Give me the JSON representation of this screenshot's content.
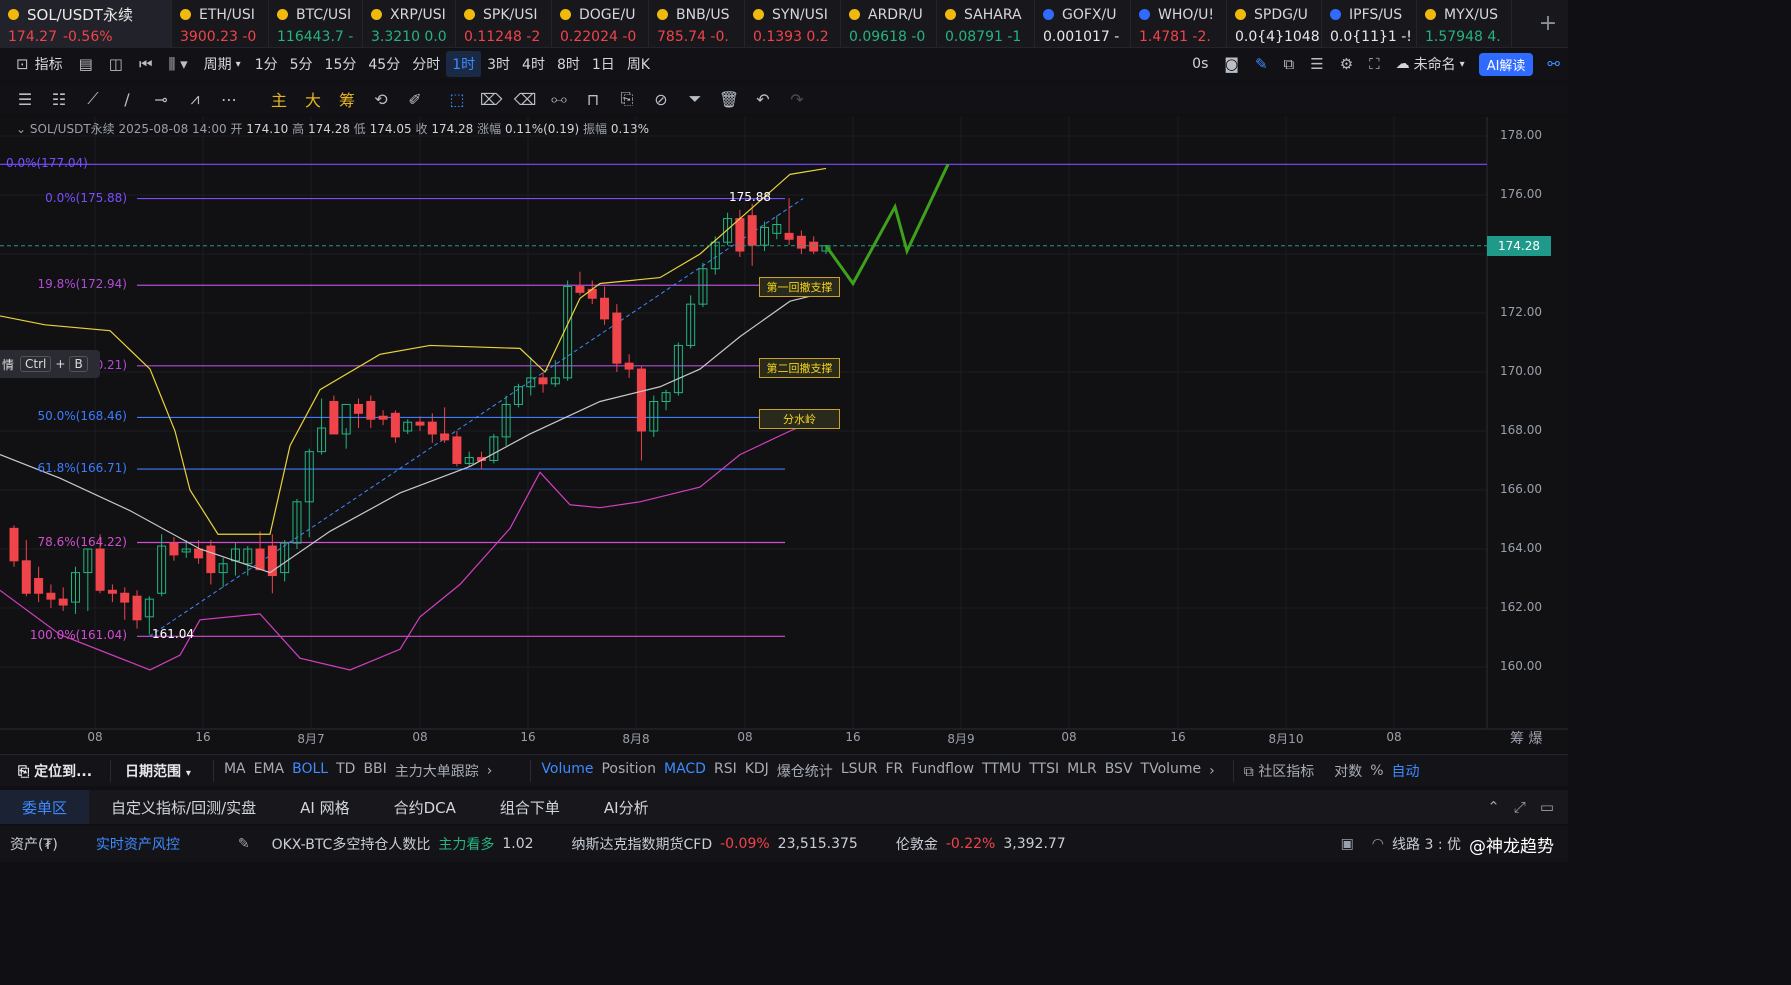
{
  "tickers": [
    {
      "name": "SOL/USDT永续",
      "price": "174.27",
      "change": "-0.56%",
      "dir": "down",
      "active": true
    },
    {
      "name": "ETH/USI",
      "price": "3900.23 -0",
      "dir": "down"
    },
    {
      "name": "BTC/USI",
      "price": "116443.7 -",
      "dir": "up"
    },
    {
      "name": "XRP/USI",
      "price": "3.3210 0.0",
      "dir": "up"
    },
    {
      "name": "SPK/USI",
      "price": "0.11248 -2",
      "dir": "down"
    },
    {
      "name": "DOGE/U",
      "price": "0.22024 -0",
      "dir": "down"
    },
    {
      "name": "BNB/US",
      "price": "785.74 -0.",
      "dir": "down"
    },
    {
      "name": "SYN/USI",
      "price": "0.1393 0.2",
      "dir": "down"
    },
    {
      "name": "ARDR/U",
      "price": "0.09618 -0",
      "dir": "up"
    },
    {
      "name": "SAHARA",
      "price": "0.08791 -1",
      "dir": "up"
    },
    {
      "name": "GOFX/U",
      "price": "0.001017 -",
      "dir": "flat"
    },
    {
      "name": "WHO/U!",
      "price": "1.4781 -2.",
      "dir": "down"
    },
    {
      "name": "SPDG/U",
      "price": "0.0{4}1048",
      "dir": "flat"
    },
    {
      "name": "IPFS/US",
      "price": "0.0{11}1 -!",
      "dir": "flat"
    },
    {
      "name": "MYX/US",
      "price": "1.57948 4.",
      "dir": "up"
    }
  ],
  "toolbar1": {
    "indicator": "指标",
    "period": "周期",
    "intervals": [
      "1分",
      "5分",
      "15分",
      "45分",
      "分时",
      "1时",
      "3时",
      "4时",
      "8时",
      "1日",
      "周K"
    ],
    "selected_interval": "1时",
    "countdown": "0s",
    "layout_name": "未命名",
    "ai_button": "AI解读"
  },
  "toolbar2": {
    "zhu": "主",
    "da": "大",
    "chou": "筹"
  },
  "infobar": {
    "symbol": "SOL/USDT永续",
    "datetime": "2025-08-08 14:00",
    "open_label": "开",
    "open": "174.10",
    "high_label": "高",
    "high": "174.28",
    "low_label": "低",
    "low": "174.05",
    "close_label": "收",
    "close": "174.28",
    "chg_label": "涨幅",
    "chg": "0.11%(0.19)",
    "amp_label": "振幅",
    "amp": "0.13%"
  },
  "fib_levels": [
    {
      "label": "0.0%(177.04)",
      "price": 177.04,
      "color": "#7b4dff"
    },
    {
      "label": "0.0%(175.88)",
      "price": 175.88,
      "color": "#7b4dff"
    },
    {
      "label": "19.8%(172.94)",
      "price": 172.94,
      "color": "#b04dd6"
    },
    {
      "label": "0.21)",
      "price": 170.21,
      "color": "#b04dd6"
    },
    {
      "label": "50.0%(168.46)",
      "price": 168.46,
      "color": "#3d7bff"
    },
    {
      "label": "61.8%(166.71)",
      "price": 166.71,
      "color": "#3d7bff"
    },
    {
      "label": "78.6%(164.22)",
      "price": 164.22,
      "color": "#d04fd0"
    },
    {
      "label": "100.0%(161.04)",
      "price": 161.04,
      "color": "#d04fd0"
    }
  ],
  "annotations": {
    "note1": "第一回撤支撑",
    "note2": "第二回撤支撑",
    "note3": "分水岭",
    "high_marker": "175.88",
    "low_marker": "161.04"
  },
  "last_price": "174.28",
  "y_axis": [
    "178.00",
    "176.00",
    "174.28",
    "172.00",
    "170.00",
    "168.00",
    "166.00",
    "164.00",
    "162.00",
    "160.00"
  ],
  "x_axis": [
    "08",
    "16",
    "8月7",
    "08",
    "16",
    "8月8",
    "08",
    "16",
    "8月9",
    "08",
    "16",
    "8月10",
    "08"
  ],
  "tooltip": {
    "text": "情",
    "key1": "Ctrl",
    "plus": "+",
    "key2": "B"
  },
  "candles": [
    {
      "o": 164.7,
      "h": 164.8,
      "l": 163.4,
      "c": 163.6
    },
    {
      "o": 163.6,
      "h": 164.3,
      "l": 162.4,
      "c": 162.5
    },
    {
      "o": 163.0,
      "h": 163.4,
      "l": 162.2,
      "c": 162.5
    },
    {
      "o": 162.5,
      "h": 162.8,
      "l": 162.0,
      "c": 162.3
    },
    {
      "o": 162.3,
      "h": 162.7,
      "l": 161.9,
      "c": 162.1
    },
    {
      "o": 162.2,
      "h": 163.4,
      "l": 161.8,
      "c": 163.2
    },
    {
      "o": 163.2,
      "h": 164.0,
      "l": 161.9,
      "c": 164.0
    },
    {
      "o": 164.0,
      "h": 164.5,
      "l": 162.5,
      "c": 162.6
    },
    {
      "o": 162.6,
      "h": 162.8,
      "l": 162.2,
      "c": 162.5
    },
    {
      "o": 162.5,
      "h": 162.7,
      "l": 161.6,
      "c": 162.2
    },
    {
      "o": 162.4,
      "h": 162.6,
      "l": 161.3,
      "c": 161.6
    },
    {
      "o": 161.7,
      "h": 162.4,
      "l": 161.1,
      "c": 162.3
    },
    {
      "o": 162.5,
      "h": 164.5,
      "l": 162.4,
      "c": 164.1
    },
    {
      "o": 164.2,
      "h": 164.4,
      "l": 163.6,
      "c": 163.8
    },
    {
      "o": 163.9,
      "h": 164.3,
      "l": 163.7,
      "c": 164.0
    },
    {
      "o": 164.0,
      "h": 164.3,
      "l": 163.5,
      "c": 163.7
    },
    {
      "o": 164.1,
      "h": 164.3,
      "l": 162.8,
      "c": 163.2
    },
    {
      "o": 163.2,
      "h": 163.7,
      "l": 162.7,
      "c": 163.5
    },
    {
      "o": 163.6,
      "h": 164.2,
      "l": 163.1,
      "c": 164.0
    },
    {
      "o": 163.5,
      "h": 164.1,
      "l": 163.1,
      "c": 164.0
    },
    {
      "o": 164.0,
      "h": 164.6,
      "l": 163.5,
      "c": 163.3
    },
    {
      "o": 164.1,
      "h": 164.5,
      "l": 162.5,
      "c": 163.1
    },
    {
      "o": 163.2,
      "h": 164.3,
      "l": 162.9,
      "c": 164.2
    },
    {
      "o": 164.2,
      "h": 165.7,
      "l": 164.0,
      "c": 165.6
    },
    {
      "o": 165.6,
      "h": 167.4,
      "l": 164.4,
      "c": 167.3
    },
    {
      "o": 167.3,
      "h": 169.1,
      "l": 167.2,
      "c": 168.1
    },
    {
      "o": 169.0,
      "h": 169.2,
      "l": 168.2,
      "c": 167.9
    },
    {
      "o": 167.9,
      "h": 168.1,
      "l": 167.4,
      "c": 168.9
    },
    {
      "o": 168.9,
      "h": 169.1,
      "l": 168.1,
      "c": 168.6
    },
    {
      "o": 169.0,
      "h": 169.2,
      "l": 168.1,
      "c": 168.4
    },
    {
      "o": 168.5,
      "h": 168.7,
      "l": 168.2,
      "c": 168.4
    },
    {
      "o": 168.6,
      "h": 168.7,
      "l": 167.6,
      "c": 167.8
    },
    {
      "o": 168.0,
      "h": 168.4,
      "l": 167.9,
      "c": 168.3
    },
    {
      "o": 168.3,
      "h": 168.5,
      "l": 168.0,
      "c": 168.2
    },
    {
      "o": 168.3,
      "h": 168.6,
      "l": 167.6,
      "c": 167.9
    },
    {
      "o": 167.9,
      "h": 168.8,
      "l": 167.6,
      "c": 167.7
    },
    {
      "o": 167.8,
      "h": 168.0,
      "l": 166.8,
      "c": 166.9
    },
    {
      "o": 166.9,
      "h": 167.3,
      "l": 166.8,
      "c": 167.1
    },
    {
      "o": 167.1,
      "h": 167.3,
      "l": 166.7,
      "c": 167.0
    },
    {
      "o": 167.0,
      "h": 167.9,
      "l": 166.9,
      "c": 167.8
    },
    {
      "o": 167.8,
      "h": 169.2,
      "l": 167.5,
      "c": 168.9
    },
    {
      "o": 168.9,
      "h": 169.6,
      "l": 168.8,
      "c": 169.5
    },
    {
      "o": 169.5,
      "h": 170.5,
      "l": 169.2,
      "c": 169.8
    },
    {
      "o": 169.8,
      "h": 170.0,
      "l": 169.3,
      "c": 169.6
    },
    {
      "o": 169.6,
      "h": 170.4,
      "l": 169.5,
      "c": 169.8
    },
    {
      "o": 169.8,
      "h": 173.1,
      "l": 169.7,
      "c": 172.9
    },
    {
      "o": 172.9,
      "h": 173.4,
      "l": 172.6,
      "c": 172.7
    },
    {
      "o": 172.8,
      "h": 173.1,
      "l": 172.3,
      "c": 172.5
    },
    {
      "o": 172.5,
      "h": 172.9,
      "l": 171.6,
      "c": 171.8
    },
    {
      "o": 172.0,
      "h": 172.3,
      "l": 170.0,
      "c": 170.3
    },
    {
      "o": 170.3,
      "h": 170.6,
      "l": 169.8,
      "c": 170.1
    },
    {
      "o": 170.1,
      "h": 170.2,
      "l": 167.0,
      "c": 168.0
    },
    {
      "o": 168.0,
      "h": 169.2,
      "l": 167.8,
      "c": 169.0
    },
    {
      "o": 169.0,
      "h": 169.4,
      "l": 168.7,
      "c": 169.3
    },
    {
      "o": 169.3,
      "h": 171.0,
      "l": 169.2,
      "c": 170.9
    },
    {
      "o": 170.9,
      "h": 172.6,
      "l": 170.8,
      "c": 172.3
    },
    {
      "o": 172.3,
      "h": 173.7,
      "l": 172.2,
      "c": 173.5
    },
    {
      "o": 173.5,
      "h": 174.6,
      "l": 173.3,
      "c": 174.4
    },
    {
      "o": 174.4,
      "h": 175.4,
      "l": 174.3,
      "c": 175.2
    },
    {
      "o": 175.2,
      "h": 175.5,
      "l": 173.9,
      "c": 174.1
    },
    {
      "o": 175.3,
      "h": 175.7,
      "l": 173.6,
      "c": 174.3
    },
    {
      "o": 174.3,
      "h": 175.1,
      "l": 174.1,
      "c": 174.9
    },
    {
      "o": 174.7,
      "h": 175.3,
      "l": 174.5,
      "c": 175.0
    },
    {
      "o": 174.7,
      "h": 175.9,
      "l": 174.3,
      "c": 174.5
    },
    {
      "o": 174.6,
      "h": 174.8,
      "l": 174.0,
      "c": 174.2
    },
    {
      "o": 174.4,
      "h": 174.6,
      "l": 174.0,
      "c": 174.1
    },
    {
      "o": 174.1,
      "h": 174.3,
      "l": 174.0,
      "c": 174.28
    }
  ],
  "ind_bar": {
    "locate": "定位到...",
    "date_range": "日期范围",
    "main_indicators": [
      "MA",
      "EMA",
      "BOLL",
      "TD",
      "BBI",
      "主力大单跟踪"
    ],
    "main_selected": "BOLL",
    "sub_indicators": [
      "Volume",
      "Position",
      "MACD",
      "RSI",
      "KDJ",
      "爆仓统计",
      "LSUR",
      "FR",
      "Fundflow",
      "TTMU",
      "TTSI",
      "MLR",
      "BSV",
      "TVolume"
    ],
    "sub_selected": [
      "Volume",
      "MACD"
    ],
    "community": "社区指标",
    "log": "对数",
    "pct": "%",
    "auto": "自动"
  },
  "panel_tabs": [
    "委单区",
    "自定义指标/回测/实盘",
    "AI 网格",
    "合约DCA",
    "组合下单",
    "AI分析"
  ],
  "status": {
    "assets": "资产(₮)",
    "risk": "实时资产风控",
    "item1_label": "OKX-BTC多空持仓人数比",
    "item1_tag": "主力看多",
    "item1_val": "1.02",
    "item2_label": "纳斯达克指数期货CFD",
    "item2_chg": "-0.09%",
    "item2_val": "23,515.375",
    "item3_label": "伦敦金",
    "item3_chg": "-0.22%",
    "item3_val": "3,392.77",
    "line": "线路 3 : 优",
    "watermark": "@神龙趋势"
  },
  "colors": {
    "up": "#24b47e",
    "down": "#f0444b",
    "accent": "#3d8bff",
    "boll_upper": "#e8d33a",
    "boll_mid": "#c8c8c8",
    "boll_lower": "#d23fc0",
    "projection": "#3ea11c",
    "last_line": "#1f9a8a"
  }
}
